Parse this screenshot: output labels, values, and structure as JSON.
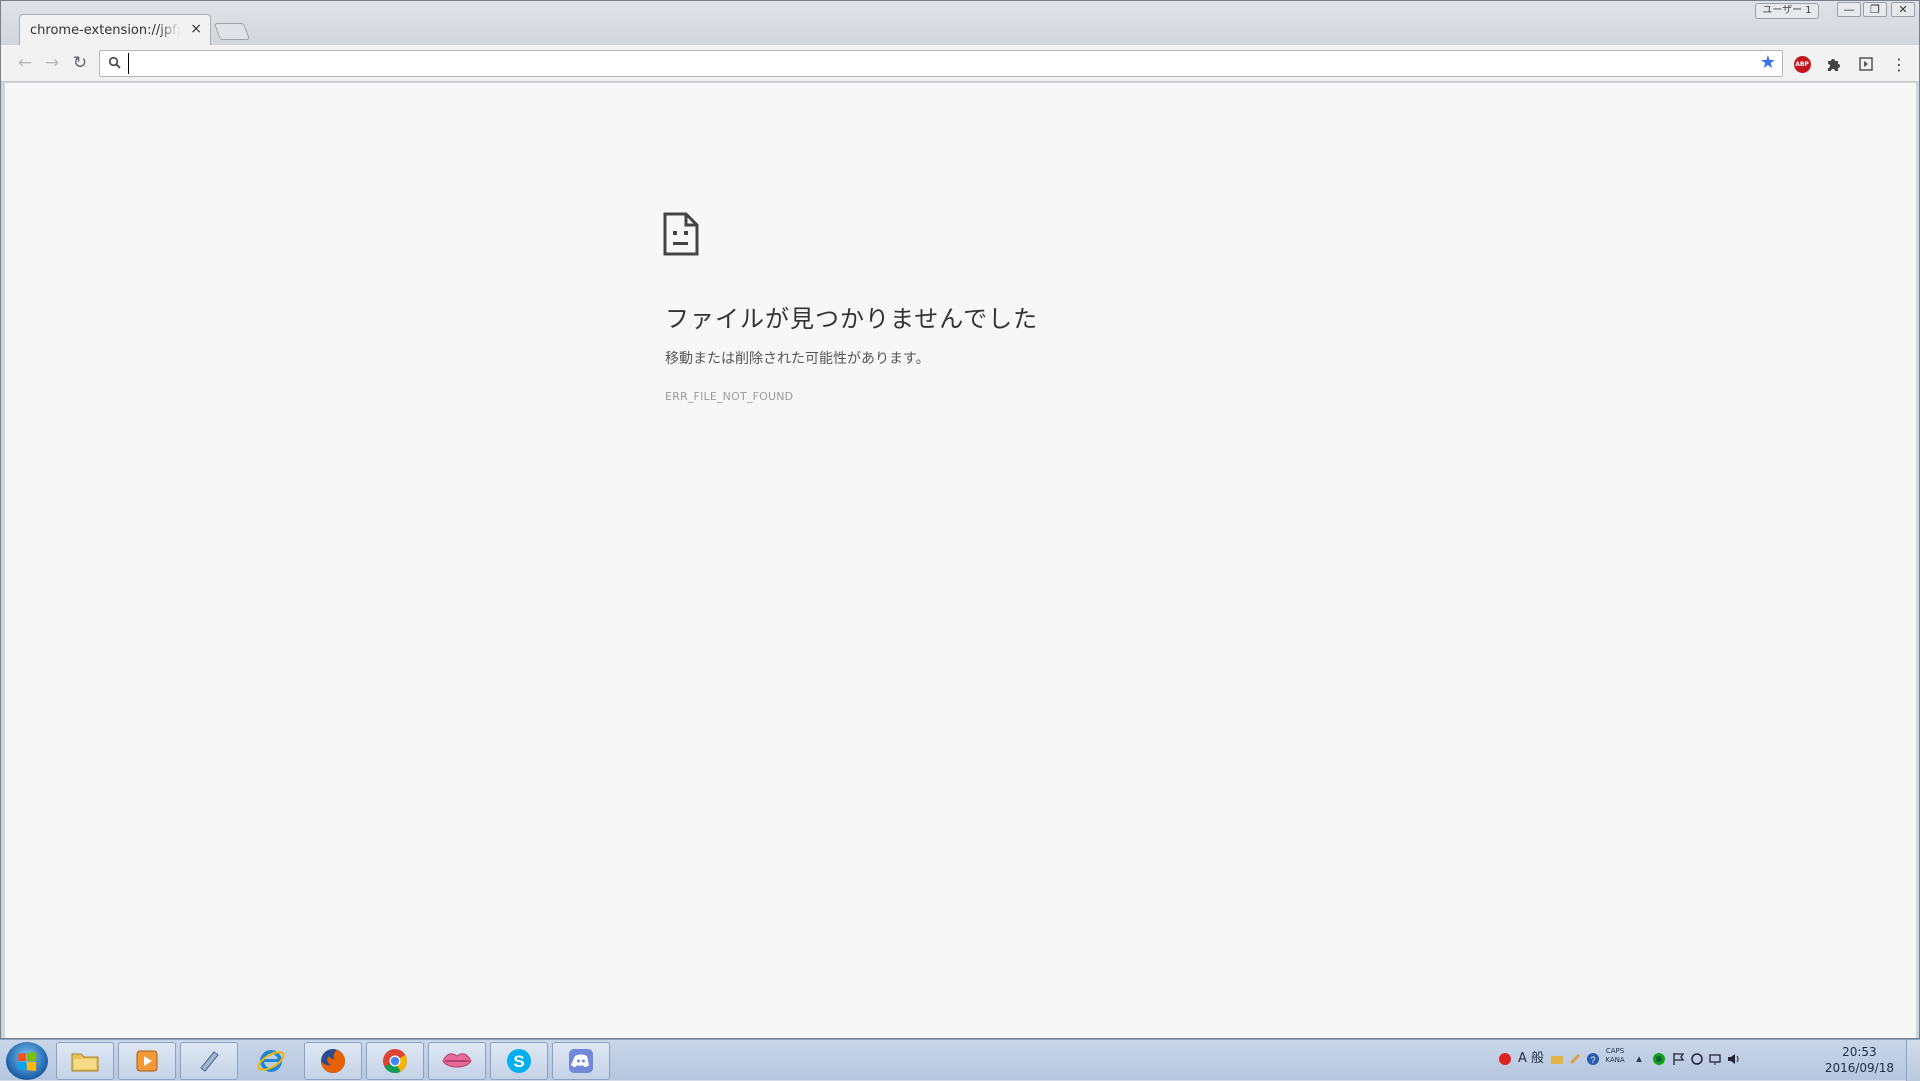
{
  "window": {
    "profile_label": "ユーザー 1",
    "minimize": "—",
    "maximize": "❐",
    "close": "✕"
  },
  "tab": {
    "title": "chrome-extension://jpfpebmajhhopeonhlcgidhclcccjcik",
    "close": "×"
  },
  "toolbar": {
    "back": "←",
    "forward": "→",
    "reload": "↻",
    "url_value": "",
    "star": "★",
    "menu": "⋮"
  },
  "page": {
    "title": "ファイルが見つかりませんでした",
    "description": "移動または削除された可能性があります。",
    "error_code": "ERR_FILE_NOT_FOUND"
  },
  "taskbar": {
    "apps": [
      {
        "name": "explorer",
        "icon": "folder-icon"
      },
      {
        "name": "media player",
        "icon": "media-player-icon"
      },
      {
        "name": "notes",
        "icon": "notepad-icon"
      },
      {
        "name": "internet explorer",
        "icon": "ie-icon"
      },
      {
        "name": "firefox",
        "icon": "firefox-icon"
      },
      {
        "name": "chrome",
        "icon": "chrome-icon"
      },
      {
        "name": "lips app",
        "icon": "lips-icon"
      },
      {
        "name": "skype",
        "icon": "skype-icon"
      },
      {
        "name": "discord",
        "icon": "discord-icon"
      }
    ],
    "ime_label": "A 般",
    "caps_label": "CAPS",
    "kana_label": "KANA",
    "time": "20:53",
    "date": "2016/09/18"
  },
  "colors": {
    "page_bg": "#f7f7f7",
    "star": "#3a73e6",
    "abp": "#c6161b"
  }
}
